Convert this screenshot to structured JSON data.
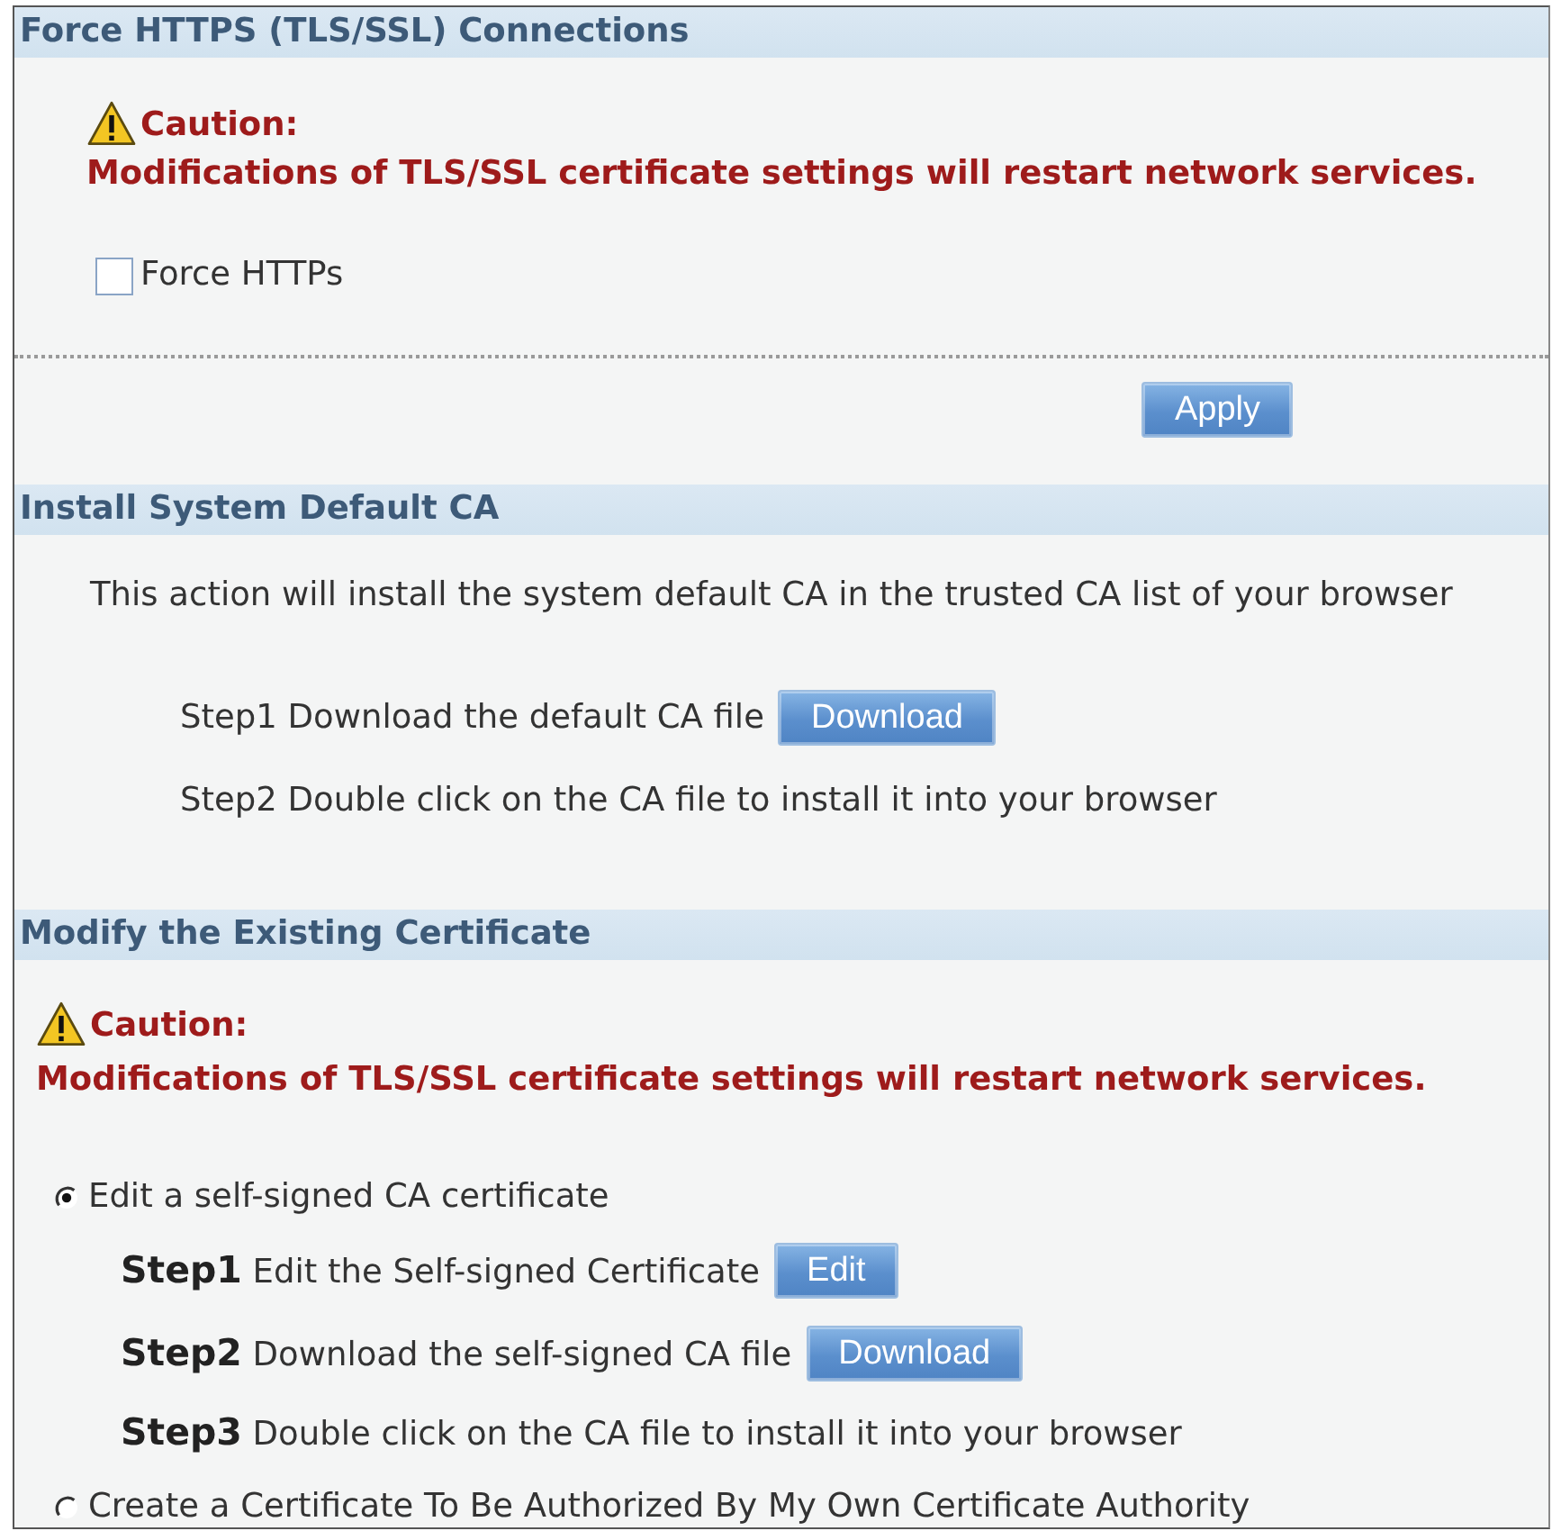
{
  "sections": [
    {
      "title": "Force HTTPS (TLS/SSL) Connections",
      "items": [
        {
          "kind": "caution",
          "label": "Caution:",
          "message": "Modifications of TLS/SSL certificate settings will restart network services."
        },
        {
          "kind": "checkbox",
          "label": "Force HTTPs",
          "checked": false
        },
        {
          "kind": "actions",
          "buttons": [
            "Apply"
          ]
        }
      ]
    },
    {
      "title": "Install System Default CA",
      "items": [
        {
          "kind": "paragraph",
          "text": "This action will install the system default CA in the trusted CA list of your browser"
        },
        {
          "kind": "step",
          "text": "Step1 Download the default CA file",
          "button": "Download"
        },
        {
          "kind": "step",
          "text": "Step2 Double click on the CA file to install it into your browser"
        }
      ]
    },
    {
      "title": "Modify the Existing Certificate",
      "items": [
        {
          "kind": "caution",
          "label": "Caution:",
          "message": "Modifications of TLS/SSL certificate settings will restart network services."
        },
        {
          "kind": "radio_group",
          "options": [
            {
              "label": "Edit a self-signed CA certificate",
              "selected": true,
              "steps": [
                {
                  "text": "**Step1** Edit the Self-signed Certificate",
                  "button": "Edit"
                },
                {
                  "text": "**Step2** Download the self-signed CA file",
                  "button": "Download"
                },
                {
                  "text": "**Step3** Double click on the CA file to install it into your browser"
                }
              ]
            },
            {
              "label": "Create a Certificate To Be Authorized By My Own Certificate Authority",
              "selected": false
            }
          ]
        }
      ]
    }
  ]
}
